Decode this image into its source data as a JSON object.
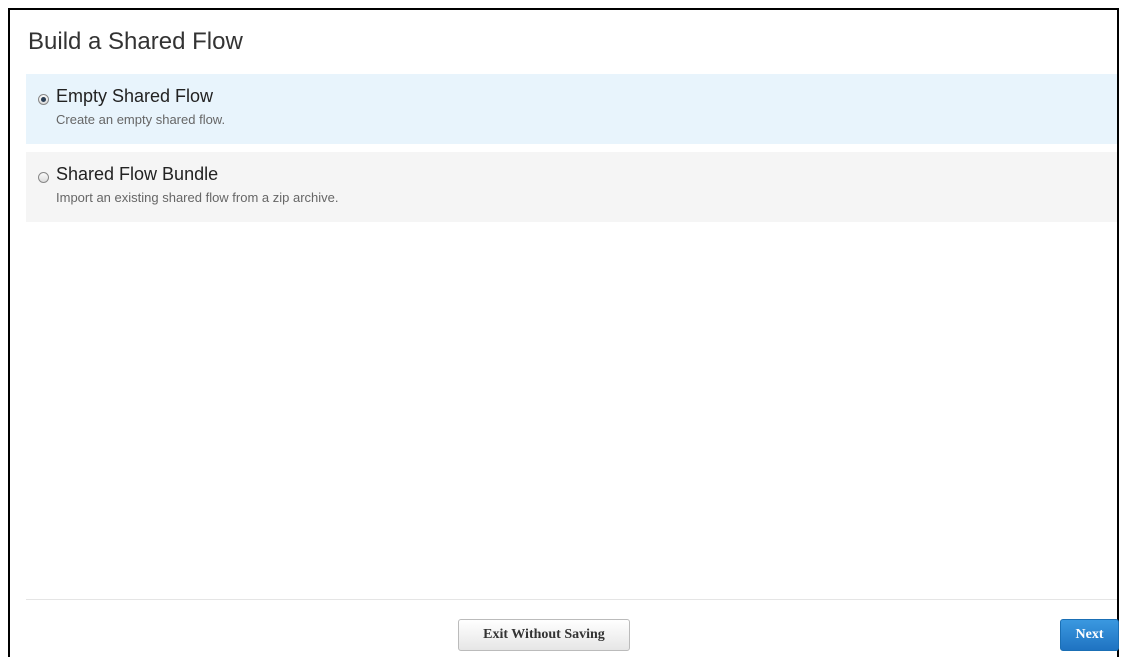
{
  "dialog": {
    "title": "Build a Shared Flow"
  },
  "options": [
    {
      "title": "Empty Shared Flow",
      "description": "Create an empty shared flow.",
      "selected": true
    },
    {
      "title": "Shared Flow Bundle",
      "description": "Import an existing shared flow from a zip archive.",
      "selected": false
    }
  ],
  "footer": {
    "exit_label": "Exit Without Saving",
    "next_label": "Next"
  },
  "colors": {
    "selected_bg": "#e8f4fc",
    "unselected_bg": "#f5f5f5",
    "primary": "#1f73c2"
  }
}
